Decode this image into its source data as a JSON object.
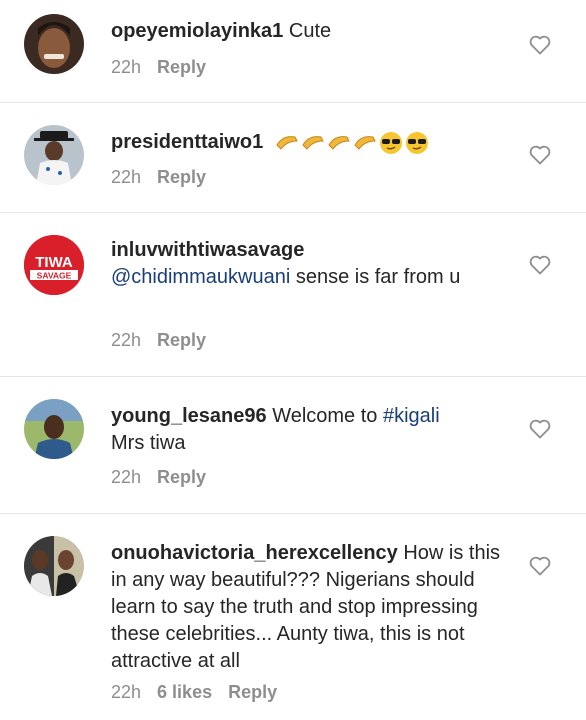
{
  "comments": [
    {
      "username": "opeyemiolayinka1",
      "text": "Cute",
      "time": "22h",
      "likes": "",
      "reply_label": "Reply",
      "avatar": "woman-smiling"
    },
    {
      "username": "presidenttaiwo1",
      "text": "",
      "emojis": [
        "clap-emoji",
        "clap-emoji",
        "clap-emoji",
        "clap-emoji",
        "sunglasses-emoji",
        "sunglasses-emoji"
      ],
      "time": "22h",
      "likes": "",
      "reply_label": "Reply",
      "avatar": "man-in-hat"
    },
    {
      "username": "inluvwithtiwasavage",
      "mention": "@chidimmaukwuani",
      "text": "sense is far from u",
      "time": "22h",
      "likes": "",
      "reply_label": "Reply",
      "avatar": "tiwa-savage-logo",
      "avatar_text_top": "TIWA",
      "avatar_text_bottom": "SAVAGE"
    },
    {
      "username": "young_lesane96",
      "text_before": "Welcome to",
      "hashtag": "#kigali",
      "text_after": "Mrs tiwa",
      "time": "22h",
      "likes": "",
      "reply_label": "Reply",
      "avatar": "man-outdoors"
    },
    {
      "username": "onuohavictoria_herexcellency",
      "text": "How is this in any way beautiful??? Nigerians should learn to say the truth and stop impressing these celebrities... Aunty tiwa, this is not attractive at all",
      "time": "22h",
      "likes": "6 likes",
      "reply_label": "Reply",
      "avatar": "two-women"
    }
  ],
  "colors": {
    "text": "#262626",
    "muted": "#8e8e8e",
    "link": "#1a3e7a",
    "divider": "#e6e6e6",
    "tiwa_red": "#d9202a"
  }
}
